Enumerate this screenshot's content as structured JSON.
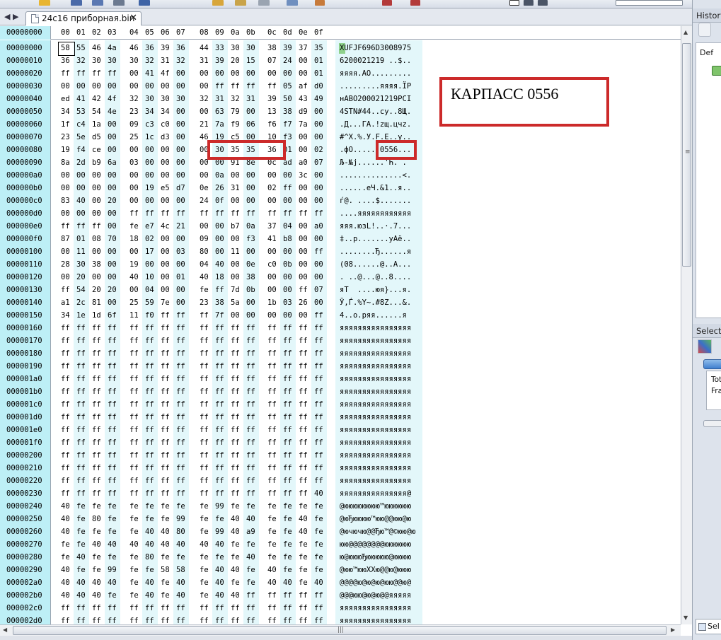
{
  "tab": {
    "title": "24c16 приборная.bin",
    "close": "✕",
    "nav_prev": "◀",
    "nav_next": "▶"
  },
  "header": {
    "offset": "00000000",
    "bytes": [
      "00",
      "01",
      "02",
      "03",
      "04",
      "05",
      "06",
      "07",
      "08",
      "09",
      "0a",
      "0b",
      "0c",
      "0d",
      "0e",
      "0f"
    ]
  },
  "rows": [
    {
      "offset": "00000000",
      "bytes": [
        "58",
        "55",
        "46",
        "4a",
        "46",
        "36",
        "39",
        "36",
        "44",
        "33",
        "30",
        "30",
        "38",
        "39",
        "37",
        "35"
      ],
      "ascii": "XUFJF696D3008975"
    },
    {
      "offset": "00000010",
      "bytes": [
        "36",
        "32",
        "30",
        "30",
        "30",
        "32",
        "31",
        "32",
        "31",
        "39",
        "20",
        "15",
        "07",
        "24",
        "00",
        "01"
      ],
      "ascii": "6200021219 ..$.."
    },
    {
      "offset": "00000020",
      "bytes": [
        "ff",
        "ff",
        "ff",
        "ff",
        "00",
        "41",
        "4f",
        "00",
        "00",
        "00",
        "00",
        "00",
        "00",
        "00",
        "00",
        "01"
      ],
      "ascii": "яяяя.AO........."
    },
    {
      "offset": "00000030",
      "bytes": [
        "00",
        "00",
        "00",
        "00",
        "00",
        "00",
        "00",
        "00",
        "00",
        "ff",
        "ff",
        "ff",
        "ff",
        "05",
        "af",
        "d0"
      ],
      "ascii": ".........яяяя.ЇР"
    },
    {
      "offset": "00000040",
      "bytes": [
        "ed",
        "41",
        "42",
        "4f",
        "32",
        "30",
        "30",
        "30",
        "32",
        "31",
        "32",
        "31",
        "39",
        "50",
        "43",
        "49"
      ],
      "ascii": "нABO200021219PCI"
    },
    {
      "offset": "00000050",
      "bytes": [
        "34",
        "53",
        "54",
        "4e",
        "23",
        "34",
        "34",
        "00",
        "00",
        "63",
        "79",
        "00",
        "13",
        "38",
        "d9",
        "00"
      ],
      "ascii": "4STN#44..cy..8Щ."
    },
    {
      "offset": "00000060",
      "bytes": [
        "1f",
        "c4",
        "1a",
        "00",
        "09",
        "c3",
        "c0",
        "00",
        "21",
        "7a",
        "f9",
        "06",
        "f6",
        "f7",
        "7a",
        "00"
      ],
      "ascii": ".Д...ГА.!zщ.цчz."
    },
    {
      "offset": "00000070",
      "bytes": [
        "23",
        "5e",
        "d5",
        "00",
        "25",
        "1c",
        "d3",
        "00",
        "46",
        "19",
        "c5",
        "00",
        "10",
        "f3",
        "00",
        "00"
      ],
      "ascii": "#^Х.%.У.F.Е..у.."
    },
    {
      "offset": "00000080",
      "bytes": [
        "19",
        "f4",
        "ce",
        "00",
        "00",
        "00",
        "00",
        "00",
        "00",
        "30",
        "35",
        "35",
        "36",
        "01",
        "00",
        "02"
      ],
      "ascii": ".фО......0556..."
    },
    {
      "offset": "00000090",
      "bytes": [
        "8a",
        "2d",
        "b9",
        "6a",
        "03",
        "00",
        "00",
        "00",
        "00",
        "00",
        "91",
        "8e",
        "0c",
        "ad",
        "a0",
        "07"
      ],
      "ascii": "Љ-№j......'Ћ.­ ."
    },
    {
      "offset": "000000a0",
      "bytes": [
        "00",
        "00",
        "00",
        "00",
        "00",
        "00",
        "00",
        "00",
        "00",
        "0a",
        "00",
        "00",
        "00",
        "00",
        "3c",
        "00"
      ],
      "ascii": "..............<."
    },
    {
      "offset": "000000b0",
      "bytes": [
        "00",
        "00",
        "00",
        "00",
        "00",
        "19",
        "e5",
        "d7",
        "0e",
        "26",
        "31",
        "00",
        "02",
        "ff",
        "00",
        "00"
      ],
      "ascii": "......еЧ.&1..я.."
    },
    {
      "offset": "000000c0",
      "bytes": [
        "83",
        "40",
        "00",
        "20",
        "00",
        "00",
        "00",
        "00",
        "24",
        "0f",
        "00",
        "00",
        "00",
        "00",
        "00",
        "00"
      ],
      "ascii": "ѓ@. ....$......."
    },
    {
      "offset": "000000d0",
      "bytes": [
        "00",
        "00",
        "00",
        "00",
        "ff",
        "ff",
        "ff",
        "ff",
        "ff",
        "ff",
        "ff",
        "ff",
        "ff",
        "ff",
        "ff",
        "ff"
      ],
      "ascii": "....яяяяяяяяяяяя"
    },
    {
      "offset": "000000e0",
      "bytes": [
        "ff",
        "ff",
        "ff",
        "00",
        "fe",
        "e7",
        "4c",
        "21",
        "00",
        "00",
        "b7",
        "0a",
        "37",
        "04",
        "00",
        "a0"
      ],
      "ascii": "яяя.юзL!..·.7..."
    },
    {
      "offset": "000000f0",
      "bytes": [
        "87",
        "01",
        "08",
        "70",
        "18",
        "02",
        "00",
        "00",
        "09",
        "00",
        "00",
        "f3",
        "41",
        "b8",
        "00",
        "00"
      ],
      "ascii": "‡..p.......уAё.."
    },
    {
      "offset": "00000100",
      "bytes": [
        "00",
        "11",
        "00",
        "00",
        "00",
        "17",
        "00",
        "03",
        "80",
        "00",
        "11",
        "00",
        "00",
        "00",
        "00",
        "ff"
      ],
      "ascii": "........Ђ......я"
    },
    {
      "offset": "00000110",
      "bytes": [
        "28",
        "30",
        "38",
        "00",
        "19",
        "00",
        "00",
        "00",
        "04",
        "40",
        "00",
        "0e",
        "c0",
        "0b",
        "00",
        "00"
      ],
      "ascii": "(08......@..А..."
    },
    {
      "offset": "00000120",
      "bytes": [
        "00",
        "20",
        "00",
        "00",
        "40",
        "10",
        "00",
        "01",
        "40",
        "18",
        "00",
        "38",
        "00",
        "00",
        "00",
        "00"
      ],
      "ascii": ". ..@...@..8...."
    },
    {
      "offset": "00000130",
      "bytes": [
        "ff",
        "54",
        "20",
        "20",
        "00",
        "04",
        "00",
        "00",
        "fe",
        "ff",
        "7d",
        "0b",
        "00",
        "00",
        "ff",
        "07"
      ],
      "ascii": "яT  ....юя}...я."
    },
    {
      "offset": "00000140",
      "bytes": [
        "a1",
        "2c",
        "81",
        "00",
        "25",
        "59",
        "7e",
        "00",
        "23",
        "38",
        "5a",
        "00",
        "1b",
        "03",
        "26",
        "00"
      ],
      "ascii": "Ў,Ѓ.%Y~.#8Z...&."
    },
    {
      "offset": "00000150",
      "bytes": [
        "34",
        "1e",
        "1d",
        "6f",
        "11",
        "f0",
        "ff",
        "ff",
        "ff",
        "7f",
        "00",
        "00",
        "00",
        "00",
        "00",
        "ff"
      ],
      "ascii": "4..o.ряя......я"
    },
    {
      "offset": "00000160",
      "bytes": [
        "ff",
        "ff",
        "ff",
        "ff",
        "ff",
        "ff",
        "ff",
        "ff",
        "ff",
        "ff",
        "ff",
        "ff",
        "ff",
        "ff",
        "ff",
        "ff"
      ],
      "ascii": "яяяяяяяяяяяяяяяя"
    },
    {
      "offset": "00000170",
      "bytes": [
        "ff",
        "ff",
        "ff",
        "ff",
        "ff",
        "ff",
        "ff",
        "ff",
        "ff",
        "ff",
        "ff",
        "ff",
        "ff",
        "ff",
        "ff",
        "ff"
      ],
      "ascii": "яяяяяяяяяяяяяяяя"
    },
    {
      "offset": "00000180",
      "bytes": [
        "ff",
        "ff",
        "ff",
        "ff",
        "ff",
        "ff",
        "ff",
        "ff",
        "ff",
        "ff",
        "ff",
        "ff",
        "ff",
        "ff",
        "ff",
        "ff"
      ],
      "ascii": "яяяяяяяяяяяяяяяя"
    },
    {
      "offset": "00000190",
      "bytes": [
        "ff",
        "ff",
        "ff",
        "ff",
        "ff",
        "ff",
        "ff",
        "ff",
        "ff",
        "ff",
        "ff",
        "ff",
        "ff",
        "ff",
        "ff",
        "ff"
      ],
      "ascii": "яяяяяяяяяяяяяяяя"
    },
    {
      "offset": "000001a0",
      "bytes": [
        "ff",
        "ff",
        "ff",
        "ff",
        "ff",
        "ff",
        "ff",
        "ff",
        "ff",
        "ff",
        "ff",
        "ff",
        "ff",
        "ff",
        "ff",
        "ff"
      ],
      "ascii": "яяяяяяяяяяяяяяяя"
    },
    {
      "offset": "000001b0",
      "bytes": [
        "ff",
        "ff",
        "ff",
        "ff",
        "ff",
        "ff",
        "ff",
        "ff",
        "ff",
        "ff",
        "ff",
        "ff",
        "ff",
        "ff",
        "ff",
        "ff"
      ],
      "ascii": "яяяяяяяяяяяяяяяя"
    },
    {
      "offset": "000001c0",
      "bytes": [
        "ff",
        "ff",
        "ff",
        "ff",
        "ff",
        "ff",
        "ff",
        "ff",
        "ff",
        "ff",
        "ff",
        "ff",
        "ff",
        "ff",
        "ff",
        "ff"
      ],
      "ascii": "яяяяяяяяяяяяяяяя"
    },
    {
      "offset": "000001d0",
      "bytes": [
        "ff",
        "ff",
        "ff",
        "ff",
        "ff",
        "ff",
        "ff",
        "ff",
        "ff",
        "ff",
        "ff",
        "ff",
        "ff",
        "ff",
        "ff",
        "ff"
      ],
      "ascii": "яяяяяяяяяяяяяяяя"
    },
    {
      "offset": "000001e0",
      "bytes": [
        "ff",
        "ff",
        "ff",
        "ff",
        "ff",
        "ff",
        "ff",
        "ff",
        "ff",
        "ff",
        "ff",
        "ff",
        "ff",
        "ff",
        "ff",
        "ff"
      ],
      "ascii": "яяяяяяяяяяяяяяяя"
    },
    {
      "offset": "000001f0",
      "bytes": [
        "ff",
        "ff",
        "ff",
        "ff",
        "ff",
        "ff",
        "ff",
        "ff",
        "ff",
        "ff",
        "ff",
        "ff",
        "ff",
        "ff",
        "ff",
        "ff"
      ],
      "ascii": "яяяяяяяяяяяяяяяя"
    },
    {
      "offset": "00000200",
      "bytes": [
        "ff",
        "ff",
        "ff",
        "ff",
        "ff",
        "ff",
        "ff",
        "ff",
        "ff",
        "ff",
        "ff",
        "ff",
        "ff",
        "ff",
        "ff",
        "ff"
      ],
      "ascii": "яяяяяяяяяяяяяяяя"
    },
    {
      "offset": "00000210",
      "bytes": [
        "ff",
        "ff",
        "ff",
        "ff",
        "ff",
        "ff",
        "ff",
        "ff",
        "ff",
        "ff",
        "ff",
        "ff",
        "ff",
        "ff",
        "ff",
        "ff"
      ],
      "ascii": "яяяяяяяяяяяяяяяя"
    },
    {
      "offset": "00000220",
      "bytes": [
        "ff",
        "ff",
        "ff",
        "ff",
        "ff",
        "ff",
        "ff",
        "ff",
        "ff",
        "ff",
        "ff",
        "ff",
        "ff",
        "ff",
        "ff",
        "ff"
      ],
      "ascii": "яяяяяяяяяяяяяяяя"
    },
    {
      "offset": "00000230",
      "bytes": [
        "ff",
        "ff",
        "ff",
        "ff",
        "ff",
        "ff",
        "ff",
        "ff",
        "ff",
        "ff",
        "ff",
        "ff",
        "ff",
        "ff",
        "ff",
        "40"
      ],
      "ascii": "яяяяяяяяяяяяяяя@"
    },
    {
      "offset": "00000240",
      "bytes": [
        "40",
        "fe",
        "fe",
        "fe",
        "fe",
        "fe",
        "fe",
        "fe",
        "fe",
        "99",
        "fe",
        "fe",
        "fe",
        "fe",
        "fe",
        "fe"
      ],
      "ascii": "@юююююююю™юююююю"
    },
    {
      "offset": "00000250",
      "bytes": [
        "40",
        "fe",
        "80",
        "fe",
        "fe",
        "fe",
        "fe",
        "99",
        "fe",
        "fe",
        "40",
        "40",
        "fe",
        "fe",
        "40",
        "fe"
      ],
      "ascii": "@юЂюююю™юю@@юю@ю"
    },
    {
      "offset": "00000260",
      "bytes": [
        "40",
        "fe",
        "fe",
        "fe",
        "fe",
        "40",
        "40",
        "80",
        "fe",
        "99",
        "40",
        "a9",
        "fe",
        "fe",
        "40",
        "fe"
      ],
      "ascii": "@ючючю@@Ђю™@©юю@ю"
    },
    {
      "offset": "00000270",
      "bytes": [
        "fe",
        "fe",
        "40",
        "40",
        "40",
        "40",
        "40",
        "40",
        "40",
        "40",
        "fe",
        "fe",
        "fe",
        "fe",
        "fe",
        "fe"
      ],
      "ascii": "юю@@@@@@@@юююююю"
    },
    {
      "offset": "00000280",
      "bytes": [
        "fe",
        "40",
        "fe",
        "fe",
        "fe",
        "80",
        "fe",
        "fe",
        "fe",
        "fe",
        "fe",
        "40",
        "fe",
        "fe",
        "fe",
        "fe"
      ],
      "ascii": "ю@юююЂююююю@юююю"
    },
    {
      "offset": "00000290",
      "bytes": [
        "40",
        "fe",
        "fe",
        "99",
        "fe",
        "fe",
        "58",
        "58",
        "fe",
        "40",
        "40",
        "fe",
        "40",
        "fe",
        "fe",
        "fe"
      ],
      "ascii": "@юю™ююXXю@@ю@ююю"
    },
    {
      "offset": "000002a0",
      "bytes": [
        "40",
        "40",
        "40",
        "40",
        "fe",
        "40",
        "fe",
        "40",
        "fe",
        "40",
        "fe",
        "fe",
        "40",
        "40",
        "fe",
        "40"
      ],
      "ascii": "@@@@ю@ю@ю@юю@@ю@"
    },
    {
      "offset": "000002b0",
      "bytes": [
        "40",
        "40",
        "40",
        "fe",
        "fe",
        "40",
        "fe",
        "40",
        "fe",
        "40",
        "40",
        "ff",
        "ff",
        "ff",
        "ff",
        "ff"
      ],
      "ascii": "@@@юю@ю@ю@@яяяяя"
    },
    {
      "offset": "000002c0",
      "bytes": [
        "ff",
        "ff",
        "ff",
        "ff",
        "ff",
        "ff",
        "ff",
        "ff",
        "ff",
        "ff",
        "ff",
        "ff",
        "ff",
        "ff",
        "ff",
        "ff"
      ],
      "ascii": "яяяяяяяяяяяяяяяя"
    },
    {
      "offset": "000002d0",
      "bytes": [
        "ff",
        "ff",
        "ff",
        "ff",
        "ff",
        "ff",
        "ff",
        "ff",
        "ff",
        "ff",
        "ff",
        "ff",
        "ff",
        "ff",
        "ff",
        "ff"
      ],
      "ascii": "яяяяяяяяяяяяяяяя"
    }
  ],
  "annotation": {
    "label": "КАРПАСС 0556",
    "color": "#cc2a2a"
  },
  "panels": {
    "history": {
      "title": "History",
      "item": "Def"
    },
    "selection": {
      "title": "Selection",
      "line1": "Tot",
      "line2": "Fra",
      "bottom_tab": "Sel"
    }
  },
  "colors": {
    "offset_bg": "#bdeff6",
    "stripe_bg": "#e3f7fa",
    "cursor": "#8fd18c"
  }
}
